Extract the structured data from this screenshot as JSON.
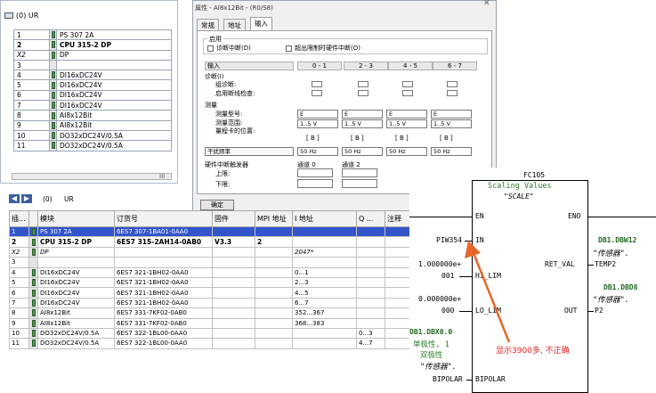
{
  "rack": {
    "title": "(0) UR",
    "rows": [
      {
        "slot": "1",
        "name": "PS 307 2A",
        "bold": false
      },
      {
        "slot": "2",
        "name": "CPU 315-2 DP",
        "bold": true
      },
      {
        "slot": "X2",
        "name": "DP",
        "bold": false
      },
      {
        "slot": "3",
        "name": "",
        "bold": false
      },
      {
        "slot": "4",
        "name": "DI16xDC24V",
        "bold": false
      },
      {
        "slot": "5",
        "name": "DI16xDC24V",
        "bold": false
      },
      {
        "slot": "6",
        "name": "DI16xDC24V",
        "bold": false
      },
      {
        "slot": "7",
        "name": "DI16xDC24V",
        "bold": false
      },
      {
        "slot": "8",
        "name": "AI8x12Bit",
        "bold": false
      },
      {
        "slot": "9",
        "name": "AI8x12Bit",
        "bold": false
      },
      {
        "slot": "10",
        "name": "DO32xDC24V/0.5A",
        "bold": false
      },
      {
        "slot": "11",
        "name": "DO32xDC24V/0.5A",
        "bold": false
      }
    ],
    "scroll_label": "III"
  },
  "dialog": {
    "title": "属性 - AI8x12Bit - (R0/S8)",
    "close": "✕",
    "tabs": [
      "常规",
      "地址",
      "输入"
    ],
    "enable_group": "启用",
    "diag_interrupt": "诊断中断(D)",
    "limit_interrupt": "超出限制时硬件中断(O)",
    "input_label": "输入",
    "channel_headers": [
      "0 - 1",
      "2 - 3",
      "4 - 5",
      "6 - 7"
    ],
    "diag_label": "诊断(I)",
    "group_diag": "组诊断:",
    "wire_check": "启用断线检查:",
    "measure_label": "测量",
    "meas_type": "测量型号:",
    "meas_range": "测量范围:",
    "range_pos": "量程卡的位置:",
    "types": [
      "E",
      "E",
      "E",
      "E"
    ],
    "ranges": [
      "1..5 V",
      "1..5 V",
      "1..5 V",
      "1..5 V"
    ],
    "positions": [
      "[ B ]",
      "[ B ]",
      "[ B ]",
      "[ B ]"
    ],
    "interference": "干扰频率",
    "freqs": [
      "50 Hz",
      "50 Hz",
      "50 Hz",
      "50 Hz"
    ],
    "hw_int": "硬件中断触发器",
    "upper": "上限:",
    "lower": "下限:",
    "ch0": "通道 0",
    "ch2": "通道 2",
    "ok": "确定"
  },
  "nav": {
    "back": "◀",
    "fwd": "▶",
    "station": "(0)",
    "rack": "UR"
  },
  "modules": {
    "headers": [
      "插...",
      "",
      "模块",
      "订货号",
      "固件",
      "MPI 地址",
      "I 地址",
      "Q ...",
      "注释"
    ],
    "rows": [
      {
        "slot": "1",
        "name": "PS 307 2A",
        "order": "6ES7 307-1BA01-0AA0",
        "fw": "",
        "mpi": "",
        "i": "",
        "q": "",
        "sel": true,
        "bold": false
      },
      {
        "slot": "2",
        "name": "CPU 315-2 DP",
        "order": "6ES7 315-2AH14-0AB0",
        "fw": "V3.3",
        "mpi": "2",
        "i": "",
        "q": "",
        "sel": false,
        "bold": true
      },
      {
        "slot": "X2",
        "name": "DP",
        "order": "",
        "fw": "",
        "mpi": "",
        "i": "2047*",
        "q": "",
        "sel": false,
        "bold": false
      },
      {
        "slot": "3",
        "name": "",
        "order": "",
        "fw": "",
        "mpi": "",
        "i": "",
        "q": "",
        "sel": false,
        "bold": false
      },
      {
        "slot": "4",
        "name": "DI16xDC24V",
        "order": "6ES7 321-1BH02-0AA0",
        "fw": "",
        "mpi": "",
        "i": "0...1",
        "q": "",
        "sel": false,
        "bold": false
      },
      {
        "slot": "5",
        "name": "DI16xDC24V",
        "order": "6ES7 321-1BH02-0AA0",
        "fw": "",
        "mpi": "",
        "i": "2...3",
        "q": "",
        "sel": false,
        "bold": false
      },
      {
        "slot": "6",
        "name": "DI16xDC24V",
        "order": "6ES7 321-1BH02-0AA0",
        "fw": "",
        "mpi": "",
        "i": "4...5",
        "q": "",
        "sel": false,
        "bold": false
      },
      {
        "slot": "7",
        "name": "DI16xDC24V",
        "order": "6ES7 321-1BH02-0AA0",
        "fw": "",
        "mpi": "",
        "i": "6...7",
        "q": "",
        "sel": false,
        "bold": false
      },
      {
        "slot": "8",
        "name": "AI8x12Bit",
        "order": "6ES7 331-7KF02-0AB0",
        "fw": "",
        "mpi": "",
        "i": "352...367",
        "q": "",
        "sel": false,
        "bold": false
      },
      {
        "slot": "9",
        "name": "AI8x12Bit",
        "order": "6ES7 331-7KF02-0AB0",
        "fw": "",
        "mpi": "",
        "i": "368...383",
        "q": "",
        "sel": false,
        "bold": false
      },
      {
        "slot": "10",
        "name": "DO32xDC24V/0.5A",
        "order": "6ES7 322-1BL00-0AA0",
        "fw": "",
        "mpi": "",
        "i": "",
        "q": "0...3",
        "sel": false,
        "bold": false
      },
      {
        "slot": "11",
        "name": "DO32xDC24V/0.5A",
        "order": "6ES7 322-1BL00-0AA0",
        "fw": "",
        "mpi": "",
        "i": "",
        "q": "4...7",
        "sel": false,
        "bold": false
      }
    ]
  },
  "fc": {
    "block": "FC105",
    "desc": "Scaling Values",
    "name": "\"SCALE\"",
    "en": "EN",
    "eno": "ENO",
    "in_pin": "IN",
    "in_val": "PIW354",
    "hi_pin": "HI_LIM",
    "hi_val1": "1.000000e+",
    "hi_val2": "001",
    "lo_pin": "LO_LIM",
    "lo_val1": "0.000000e+",
    "lo_val2": "000",
    "bip_pin": "BIPOLAR",
    "bip_val": "BIPOLAR",
    "bip_c1": "DB1.DBX0.0",
    "bip_c2": "单极性, 1",
    "bip_c3": "双极性",
    "bip_c4": "\"传感器\".",
    "ret_pin": "RET_VAL",
    "ret_val": "TEMP2",
    "ret_c1": "DB1.DBW12",
    "ret_c2": "\"传感器\".",
    "out_pin": "OUT",
    "out_val": "P2",
    "out_c1": "DB1.DBD8",
    "out_c2": "\"传感器\".",
    "annotation": "显示3900多, 不正确",
    "accent": "#e8652a"
  }
}
